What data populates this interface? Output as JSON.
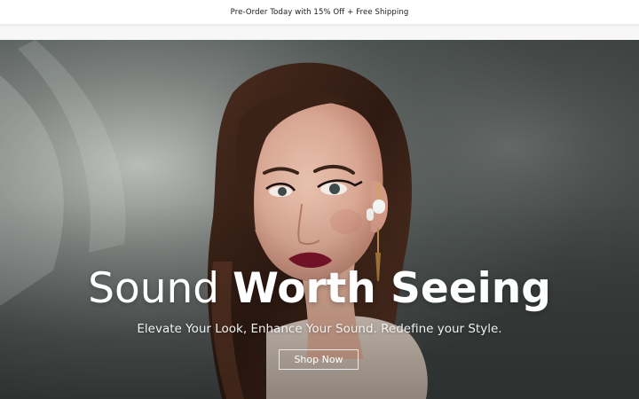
{
  "announcement": {
    "text": "Pre-Order Today with 15% Off + Free Shipping"
  },
  "hero": {
    "title_light": "Sound",
    "title_bold": "Worth Seeing",
    "subtitle": "Elevate Your Look, Enhance Your Sound. Redefine your Style.",
    "cta_label": "Shop Now",
    "image_subject": "woman-wearing-white-earbud-portrait"
  },
  "colors": {
    "backdrop": "#4a4f4f",
    "text": "#ffffff",
    "lip": "#7a1428",
    "hair": "#3a2218"
  }
}
